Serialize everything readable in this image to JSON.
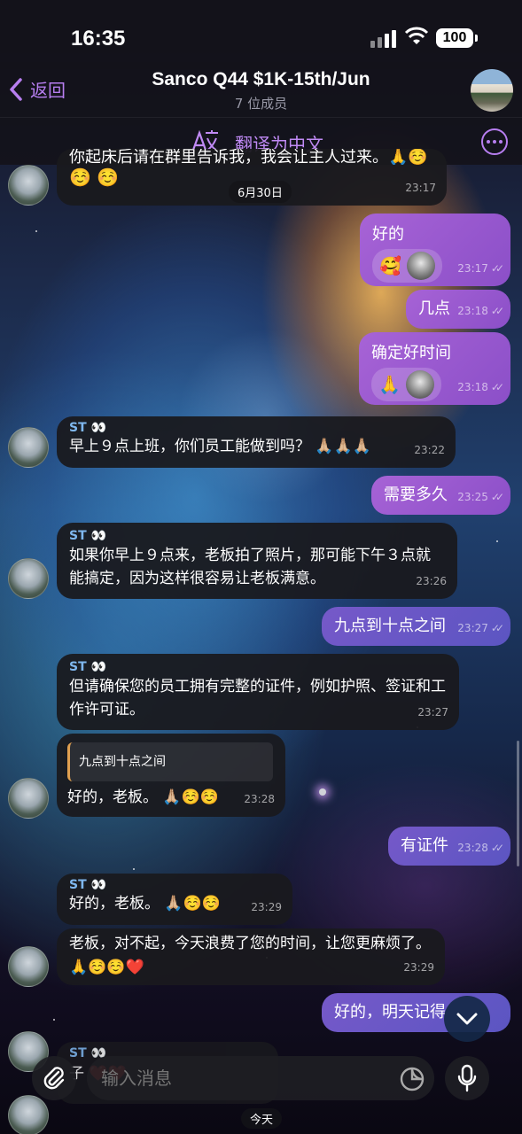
{
  "status_bar": {
    "time": "16:35",
    "battery": "100"
  },
  "header": {
    "back_label": "返回",
    "title": "Sanco Q44 $1K-15th/Jun",
    "subtitle": "7 位成员"
  },
  "translate_bar": {
    "label": "翻译为中文"
  },
  "date_divider": "6月30日",
  "messages": [
    {
      "dir": "in",
      "text": "你起床后请在群里告诉我，我会让主人过来。🙏☺️",
      "emoji": "☺️ ☺️",
      "time": "23:17"
    },
    {
      "dir": "out",
      "text": "好的",
      "emoji": "🥰",
      "time": "23:17"
    },
    {
      "dir": "out",
      "text": "几点",
      "time": "23:18"
    },
    {
      "dir": "out",
      "text": "确定好时间",
      "emoji": "🙏",
      "time": "23:18"
    },
    {
      "dir": "in",
      "sender": "ST",
      "sender_emoji": "👀",
      "text": "早上９点上班，你们员工能做到吗？",
      "emoji": "🙏🏼🙏🏼🙏🏼",
      "time": "23:22"
    },
    {
      "dir": "out",
      "text": "需要多久",
      "time": "23:25"
    },
    {
      "dir": "in",
      "sender": "ST",
      "sender_emoji": "👀",
      "text": "如果你早上９点来，老板拍了照片，那可能下午３点就能搞定，因为这样很容易让老板满意。",
      "time": "23:26"
    },
    {
      "dir": "out",
      "text": "九点到十点之间",
      "time": "23:27"
    },
    {
      "dir": "in",
      "sender": "ST",
      "sender_emoji": "👀",
      "text": "但请确保您的员工拥有完整的证件，例如护照、签证和工作许可证。",
      "time": "23:27"
    },
    {
      "dir": "in",
      "quote": "九点到十点之间",
      "text": "好的，老板。",
      "emoji": "🙏🏼☺️☺️",
      "time": "23:28"
    },
    {
      "dir": "out",
      "text": "有证件",
      "time": "23:28"
    },
    {
      "dir": "in",
      "sender": "ST",
      "sender_emoji": "👀",
      "text": "好的，老板。",
      "emoji": "🙏🏼☺️☺️",
      "time": "23:29"
    },
    {
      "dir": "in",
      "text": "老板，对不起，今天浪费了您的时间，让您更麻烦了。",
      "emoji": "🙏☺️☺️❤️",
      "time": "23:29"
    },
    {
      "dir": "out",
      "text": "好的，明天记得"
    },
    {
      "dir": "in",
      "sender": "ST",
      "sender_emoji": "👀",
      "text": "子",
      "emoji": "❤️❤️"
    }
  ],
  "today_label": "今天",
  "input": {
    "placeholder": "输入消息"
  }
}
